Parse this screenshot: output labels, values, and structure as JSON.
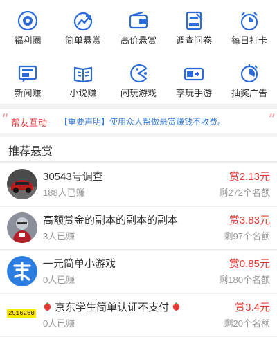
{
  "grid": [
    {
      "label": "福利圈",
      "icon": "target-icon"
    },
    {
      "label": "简单悬赏",
      "icon": "trend-icon"
    },
    {
      "label": "高价悬赏",
      "icon": "wallet-icon"
    },
    {
      "label": "调查问卷",
      "icon": "survey-icon"
    },
    {
      "label": "每日打卡",
      "icon": "alarm-clock-icon"
    },
    {
      "label": "新闻赚",
      "icon": "news-icon"
    },
    {
      "label": "小说赚",
      "icon": "book-icon"
    },
    {
      "label": "闲玩游戏",
      "icon": "pacman-icon"
    },
    {
      "label": "享玩手游",
      "icon": "gamepad-icon"
    },
    {
      "label": "抽奖广告",
      "icon": "lottery-icon"
    }
  ],
  "notice": {
    "brand": "帮友互动",
    "message": "【重要声明】使用众人帮做悬赏赚钱不收费。"
  },
  "section_title": "推荐悬赏",
  "tasks": [
    {
      "name": "30543号调查",
      "earned": "188人已赚",
      "reward": "赏2.13元",
      "remaining": "剩272个名额"
    },
    {
      "name": "高额赏金的副本的副本的副本",
      "earned": "3人已赚",
      "reward": "赏3.83元",
      "remaining": "剩97个名额"
    },
    {
      "name": "一元简单小游戏",
      "earned": "0人已赚",
      "reward": "赏0.85元",
      "remaining": "剩180个名额"
    },
    {
      "name": "京东学生简单认证不支付",
      "earned": "0人已赚",
      "reward": "赏3.4元",
      "remaining": "剩20个名额",
      "avatar_code": "2916260"
    }
  ],
  "colors": {
    "icon_blue": "#2b6cd8",
    "reward_red": "#e53935",
    "notice_blue": "#3a7bd5"
  }
}
